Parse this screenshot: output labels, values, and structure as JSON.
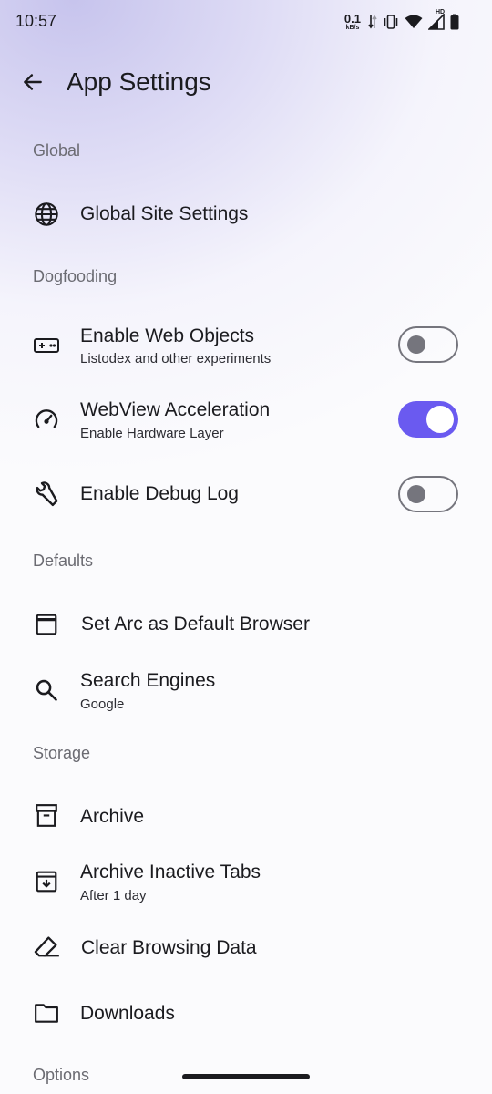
{
  "status": {
    "time": "10:57",
    "net_speed_value": "0.1",
    "net_speed_unit": "kB/s",
    "network_type": "HD",
    "icons": [
      "data-arrows-icon",
      "vibrate-icon",
      "wifi-icon",
      "cell-signal-icon",
      "battery-icon"
    ]
  },
  "app_bar": {
    "title": "App Settings",
    "back_icon": "arrow-back-icon"
  },
  "sections": {
    "global": {
      "header": "Global",
      "site_settings": {
        "title": "Global Site Settings",
        "icon": "globe-icon"
      }
    },
    "dogfooding": {
      "header": "Dogfooding",
      "web_objects": {
        "title": "Enable Web Objects",
        "subtitle": "Listodex and other experiments",
        "icon": "gamepad-icon",
        "enabled": false
      },
      "webview_acceleration": {
        "title": "WebView Acceleration",
        "subtitle": "Enable Hardware Layer",
        "icon": "speedometer-icon",
        "enabled": true
      },
      "debug_log": {
        "title": "Enable Debug Log",
        "icon": "wrench-icon",
        "enabled": false
      }
    },
    "defaults": {
      "header": "Defaults",
      "default_browser": {
        "title": "Set Arc as Default Browser",
        "icon": "browser-window-icon"
      },
      "search_engines": {
        "title": "Search Engines",
        "subtitle": "Google",
        "icon": "search-icon"
      }
    },
    "storage": {
      "header": "Storage",
      "archive": {
        "title": "Archive",
        "icon": "archive-box-icon"
      },
      "archive_inactive": {
        "title": "Archive Inactive Tabs",
        "subtitle": "After 1 day",
        "icon": "archive-download-icon"
      },
      "clear_data": {
        "title": "Clear Browsing Data",
        "icon": "eraser-icon"
      },
      "downloads": {
        "title": "Downloads",
        "icon": "folder-icon"
      }
    },
    "options": {
      "header": "Options"
    }
  },
  "colors": {
    "accent": "#6a5af0",
    "switch_off": "#75757d",
    "section_header": "#6b6b72",
    "text_primary": "#1b1b1f"
  }
}
